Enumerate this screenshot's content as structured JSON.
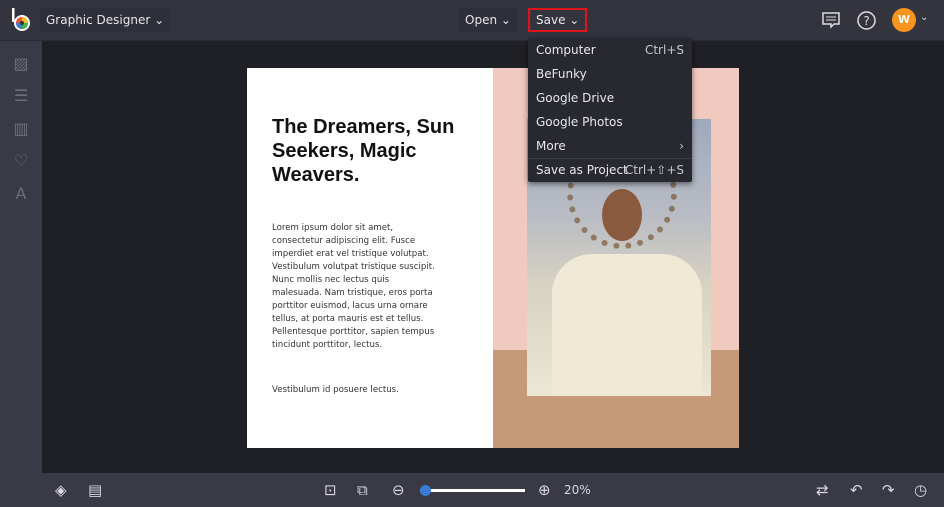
{
  "header": {
    "project": "Graphic Designer",
    "open_label": "Open",
    "save_label": "Save",
    "avatar_initial": "W"
  },
  "save_menu": {
    "items": [
      {
        "label": "Computer",
        "shortcut": "Ctrl+S"
      },
      {
        "label": "BeFunky",
        "shortcut": ""
      },
      {
        "label": "Google Drive",
        "shortcut": ""
      },
      {
        "label": "Google Photos",
        "shortcut": ""
      },
      {
        "label": "More",
        "shortcut": "›"
      },
      {
        "label": "Save as Project",
        "shortcut": "Ctrl+⇧+S"
      }
    ]
  },
  "design": {
    "headline": "The Dreamers, Sun Seekers, Magic Weavers.",
    "body": "Lorem ipsum dolor sit amet, consectetur adipiscing elit. Fusce imperdiet erat vel tristique volutpat. Vestibulum volutpat tristique suscipit. Nunc mollis nec lectus quis malesuada. Nam tristique, eros porta porttitor euismod, lacus urna ornare tellus, at porta mauris est et tellus. Pellentesque porttitor, sapien tempus tincidunt porttitor, lectus.",
    "footer": "Vestibulum id posuere lectus."
  },
  "zoom": {
    "label": "20%",
    "slider_fraction": 0.05
  },
  "colors": {
    "accent": "#3a7bd5",
    "avatar": "#f7941d",
    "highlight": "#e0141c"
  }
}
